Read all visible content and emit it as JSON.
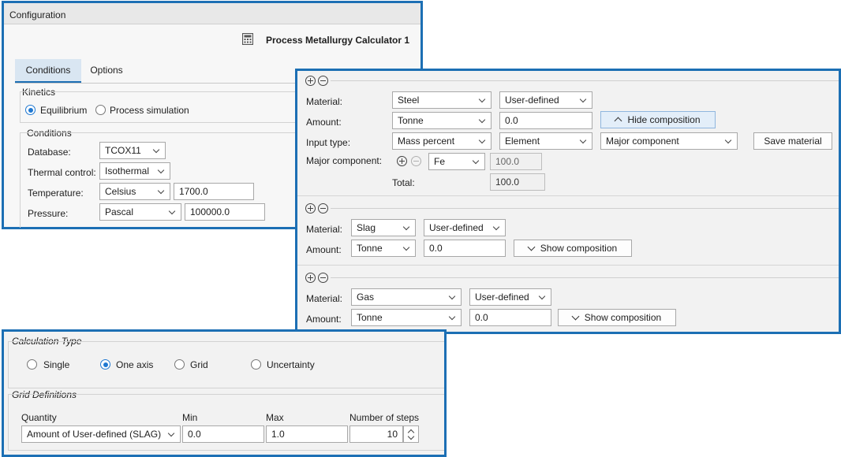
{
  "config_panel": {
    "title": "Configuration",
    "calculator_title": "Process Metallurgy Calculator 1",
    "calculator_icon": "calculator-icon",
    "tabs": [
      {
        "label": "Conditions"
      },
      {
        "label": "Options"
      }
    ],
    "kinetics": {
      "legend": "Kinetics",
      "options": [
        {
          "label": "Equilibrium",
          "selected": true
        },
        {
          "label": "Process simulation",
          "selected": false
        }
      ]
    },
    "conditions": {
      "legend": "Conditions",
      "database": {
        "label": "Database:",
        "value": "TCOX11"
      },
      "thermal_control": {
        "label": "Thermal control:",
        "value": "Isothermal"
      },
      "temperature": {
        "label": "Temperature:",
        "unit": "Celsius",
        "value": "1700.0"
      },
      "pressure": {
        "label": "Pressure:",
        "unit": "Pascal",
        "value": "100000.0"
      }
    }
  },
  "materials_panel": {
    "steel": {
      "material_label": "Material:",
      "material": "Steel",
      "type": "User-defined",
      "amount_label": "Amount:",
      "amount_unit": "Tonne",
      "amount": "0.0",
      "hide_composition": "Hide composition",
      "input_type_label": "Input type:",
      "input_type": "Mass percent",
      "basis": "Element",
      "major_component_select": "Major component",
      "save_material": "Save material",
      "major_component_label": "Major component:",
      "major_component": "Fe",
      "major_component_value": "100.0",
      "total_label": "Total:",
      "total_value": "100.0"
    },
    "slag": {
      "material_label": "Material:",
      "material": "Slag",
      "type": "User-defined",
      "amount_label": "Amount:",
      "amount_unit": "Tonne",
      "amount": "0.0",
      "show_composition": "Show composition"
    },
    "gas": {
      "material_label": "Material:",
      "material": "Gas",
      "type": "User-defined",
      "amount_label": "Amount:",
      "amount_unit": "Tonne",
      "amount": "0.0",
      "show_composition": "Show composition"
    }
  },
  "calc_panel": {
    "calc_type_legend": "Calculation Type",
    "calc_types": [
      {
        "label": "Single",
        "selected": false
      },
      {
        "label": "One axis",
        "selected": true
      },
      {
        "label": "Grid",
        "selected": false
      },
      {
        "label": "Uncertainty",
        "selected": false
      }
    ],
    "grid_legend": "Grid Definitions",
    "columns": {
      "quantity": "Quantity",
      "min": "Min",
      "max": "Max",
      "steps": "Number of steps"
    },
    "row": {
      "quantity": "Amount of User-defined (SLAG)",
      "min": "0.0",
      "max": "1.0",
      "steps": "10"
    }
  },
  "colors": {
    "accent_border": "#1c6fb4",
    "radio_selected": "#1f78d1",
    "active_tab": "#d9e6f2"
  }
}
